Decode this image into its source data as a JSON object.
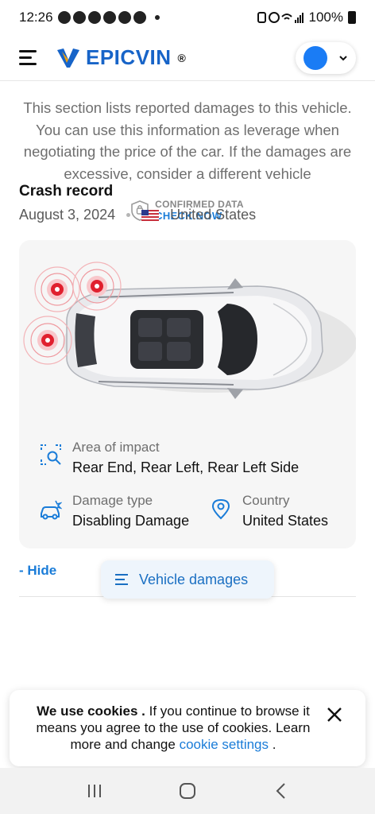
{
  "status_bar": {
    "time": "12:26",
    "battery": "100%"
  },
  "header": {
    "logo_text_a": "EPIC",
    "logo_text_b": "VIN",
    "logo_mark": "®"
  },
  "section": {
    "description": "This section lists reported damages to this vehicle. You can use this information as leverage when negotiating the price of the car. If the damages are excessive, consider a different vehicle",
    "confirmed_label": "CONFIRMED DATA",
    "check_now": "CHECK NOW"
  },
  "crash": {
    "title": "Crash record",
    "date": "August 3, 2024",
    "country": "United States",
    "area_label": "Area of impact",
    "area_value": "Rear End, Rear Left, Rear Left Side",
    "damage_label": "Damage type",
    "damage_value": "Disabling Damage",
    "country_label": "Country",
    "country_value": "United States"
  },
  "actions": {
    "hide": "- Hide",
    "vehicle_damages": "Vehicle damages"
  },
  "cookie": {
    "bold": "We use cookies .",
    "text": " If you continue to browse it means you agree to the use of cookies. Learn more and change ",
    "link": "cookie settings",
    "end": " ."
  },
  "icons": [
    "menu-icon",
    "logo-icon",
    "chevron-down-icon",
    "shield-icon",
    "impact-area-icon",
    "damage-car-icon",
    "location-pin-icon",
    "list-icon",
    "close-icon",
    "recent-apps-icon",
    "home-icon",
    "back-icon"
  ],
  "colors": {
    "brand": "#1764c8",
    "accent": "#1a7cd8",
    "impact": "#e0202e",
    "avatar": "#1a7cf5"
  }
}
